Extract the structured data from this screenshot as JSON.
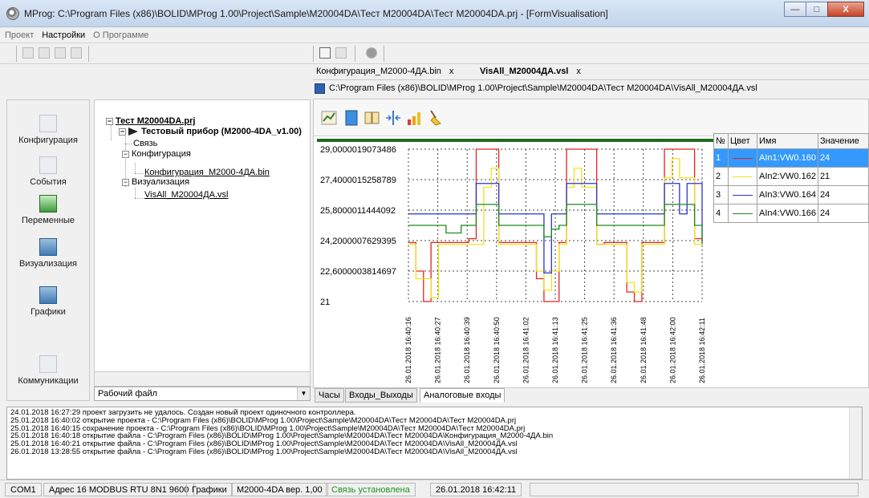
{
  "window": {
    "title": "MProg: C:\\Program Files (x86)\\BOLID\\MProg 1.00\\Project\\Sample\\M20004DA\\Тест M20004DA\\Тест M20004DA.prj - [FormVisualisation]",
    "minimize": "—",
    "maximize": "□",
    "close": "X"
  },
  "menu": [
    "Проект",
    "Настройки",
    "О Программе"
  ],
  "nav": [
    "Конфигурация",
    "События",
    "Переменные",
    "Визуализация",
    "Графики",
    "Коммуникации"
  ],
  "tree": {
    "root": "Тест M20004DA.prj",
    "device": "Тестовый прибор (M2000-4DA_v1.00)",
    "link": "Связь",
    "config": "Конфигурация",
    "config_file": "Конфигурация_M2000-4ДА.bin",
    "vis": "Визуализация",
    "vis_file": "VisAll_M20004ДА.vsl"
  },
  "combo_value": "Рабочий файл",
  "tabs": [
    {
      "label": "Конфигурация_M2000-4ДА.bin",
      "close": "x"
    },
    {
      "label": "VisAll_M20004ДА.vsl",
      "close": "x"
    }
  ],
  "path": "C:\\Program Files (x86)\\BOLID\\MProg 1.00\\Project\\Sample\\M20004DA\\Тест M20004DA\\VisAll_M20004ДА.vsl",
  "table": {
    "headers": [
      "№",
      "Цвет",
      "Имя",
      "Значение"
    ],
    "rows": [
      {
        "n": "1",
        "color": "#e52222",
        "name": "AIn1:VW0.160",
        "value": "24"
      },
      {
        "n": "2",
        "color": "#f2e21a",
        "name": "AIn2:VW0.162",
        "value": "21"
      },
      {
        "n": "3",
        "color": "#2a35c8",
        "name": "AIn3:VW0.164",
        "value": "24"
      },
      {
        "n": "4",
        "color": "#1d8a1d",
        "name": "AIn4:VW0.166",
        "value": "24"
      }
    ]
  },
  "bottom_tabs": [
    "Часы",
    "Входы_Выходы",
    "Аналоговые входы"
  ],
  "log": [
    "24.01.2018 16:27:29 проект загрузить не удалось. Создан новый проект одиночного контроллера.",
    "25.01.2018 16:40:02 открытие проекта - C:\\Program Files (x86)\\BOLID\\MProg 1.00\\Project\\Sample\\M20004DA\\Тест M20004DA\\Тест M20004DA.prj",
    "25.01.2018 16:40:15 сохранение проекта - C:\\Program Files (x86)\\BOLID\\MProg 1.00\\Project\\Sample\\M20004DA\\Тест M20004DA\\Тест M20004DA.prj",
    "25.01.2018 16:40:18 открытие файла - C:\\Program Files (x86)\\BOLID\\MProg 1.00\\Project\\Sample\\M20004DA\\Тест M20004DA\\Конфигурация_M2000-4ДА.bin",
    "25.01.2018 16:40:21 открытие файла - C:\\Program Files (x86)\\BOLID\\MProg 1.00\\Project\\Sample\\M20004DA\\Тест M20004DA\\VisAll_M20004ДА.vsl",
    "26.01.2018 13:28:55 открытие файла - C:\\Program Files (x86)\\BOLID\\MProg 1.00\\Project\\Sample\\M20004DA\\Тест M20004DA\\VisAll_M20004ДА.vsl"
  ],
  "status": [
    "COM1",
    "Адрес 16 MODBUS RTU 8N1 9600",
    "Графики",
    "M2000-4DA вер. 1,00",
    "Связь установлена",
    "26.01.2018 16:42:11"
  ],
  "colors": {
    "ok": "#1f8f1f",
    "selected": "#3399ff",
    "progress": "#1f6b1f"
  },
  "chart_data": {
    "type": "line",
    "y_ticks": [
      "29,0000019073486",
      "27,4000015258789",
      "25,8000011444092",
      "24,2000007629395",
      "22,6000003814697",
      "21"
    ],
    "ylim": [
      21,
      29.0000019073486
    ],
    "x_ticks": [
      "26.01.2018 16:40:16",
      "26.01.2018 16:40:27",
      "26.01.2018 16:40:39",
      "26.01.2018 16:40:50",
      "26.01.2018 16:41:02",
      "26.01.2018 16:41:13",
      "26.01.2018 16:41:25",
      "26.01.2018 16:41:36",
      "26.01.2018 16:41:48",
      "26.01.2018 16:42:00",
      "26.01.2018 16:42:11"
    ],
    "grid": true,
    "series": [
      {
        "name": "AIn1:VW0.160",
        "color": "#e52222",
        "values": [
          24.1,
          22.6,
          21.0,
          24.1,
          24.1,
          24.1,
          24.1,
          24.1,
          24.3,
          29.0,
          29.0,
          29.0,
          24.1,
          24.1,
          24.1,
          24.1,
          24.1,
          22.2,
          21.0,
          21.0,
          24.1,
          29.0,
          29.0,
          29.0,
          29.0,
          24.0,
          24.1,
          24.1,
          24.1,
          21.5,
          21.0,
          24.1,
          24.1,
          24.1,
          29.0,
          29.0,
          29.0,
          29.0,
          24.3,
          24.1
        ]
      },
      {
        "name": "AIn2:VW0.162",
        "color": "#f2e21a",
        "values": [
          24.0,
          22.2,
          22.2,
          21.2,
          24.0,
          24.0,
          24.0,
          24.0,
          24.0,
          24.0,
          27.0,
          28.0,
          24.0,
          24.0,
          24.0,
          24.0,
          24.0,
          22.6,
          21.6,
          22.6,
          24.0,
          27.0,
          28.0,
          27.0,
          27.0,
          24.0,
          24.0,
          24.0,
          24.0,
          22.0,
          21.5,
          24.0,
          24.0,
          24.0,
          27.5,
          28.5,
          27.5,
          27.5,
          24.0,
          24.0
        ]
      },
      {
        "name": "AIn3:VW0.164",
        "color": "#2a35c8",
        "values": [
          25.6,
          25.6,
          25.6,
          25.6,
          25.6,
          25.6,
          25.6,
          25.6,
          25.6,
          27.2,
          27.2,
          27.2,
          25.6,
          25.6,
          25.6,
          25.6,
          25.6,
          25.6,
          22.5,
          25.6,
          25.6,
          27.2,
          27.2,
          27.2,
          27.2,
          25.6,
          25.6,
          25.6,
          25.6,
          25.6,
          25.6,
          25.6,
          25.6,
          25.6,
          27.2,
          27.2,
          25.6,
          27.2,
          27.2,
          24.3
        ]
      },
      {
        "name": "AIn4:VW0.166",
        "color": "#1d8a1d",
        "values": [
          25.0,
          25.0,
          25.0,
          25.0,
          25.0,
          24.6,
          24.6,
          25.0,
          25.0,
          26.1,
          26.1,
          26.1,
          25.0,
          25.0,
          25.0,
          25.0,
          25.0,
          25.0,
          24.4,
          24.8,
          25.0,
          26.1,
          26.1,
          26.1,
          26.1,
          25.0,
          25.0,
          25.0,
          25.0,
          25.0,
          25.0,
          25.0,
          25.0,
          25.0,
          26.1,
          26.1,
          26.1,
          26.1,
          25.0,
          24.0
        ]
      }
    ]
  }
}
